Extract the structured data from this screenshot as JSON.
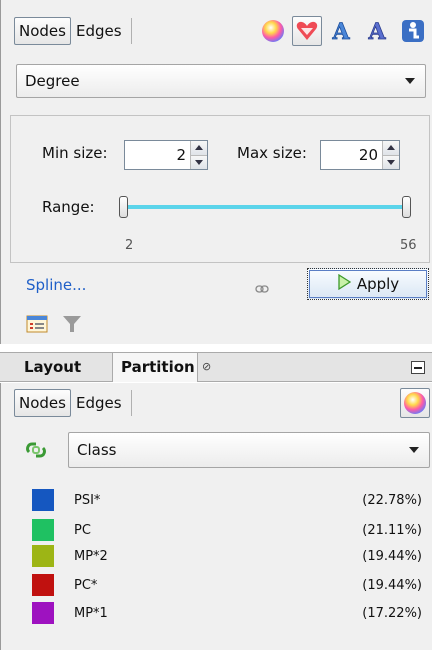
{
  "appearance": {
    "tabs": [
      "Nodes",
      "Edges"
    ],
    "ranking_attribute": "Degree",
    "min_size_label": "Min size:",
    "min_size_value": "2",
    "max_size_label": "Max size:",
    "max_size_value": "20",
    "range_label": "Range:",
    "range_min": "2",
    "range_max": "56",
    "spline_label": "Spline...",
    "apply_label": "Apply",
    "icons": [
      "color-wheel-icon",
      "size-heart-icon",
      "label-color-icon",
      "label-size-icon",
      "transformer-icon"
    ],
    "slider_color": "#5bd4ea"
  },
  "lower_panel": {
    "tab_layout": "Layout",
    "tab_partition": "Partition",
    "close_glyph": "⊘",
    "subtabs": [
      "Nodes",
      "Edges"
    ],
    "partition_attribute": "Class",
    "legend": [
      {
        "label": "PSI*",
        "percent": "(22.78%)",
        "color": "#1557c0"
      },
      {
        "label": "PC",
        "percent": "(21.11%)",
        "color": "#1fc162"
      },
      {
        "label": "MP*2",
        "percent": "(19.44%)",
        "color": "#9db515"
      },
      {
        "label": "PC*",
        "percent": "(19.44%)",
        "color": "#c0110f"
      },
      {
        "label": "MP*1",
        "percent": "(17.22%)",
        "color": "#9e12c0"
      }
    ]
  }
}
